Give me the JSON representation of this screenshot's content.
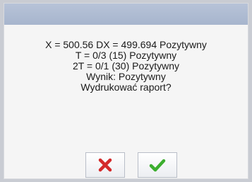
{
  "dialog": {
    "lines": [
      "X = 500.56 DX = 499.694 Pozytywny",
      "T = 0/3 (15) Pozytywny",
      "2T = 0/1 (30) Pozytywny",
      "Wynik: Pozytywny",
      "Wydrukować raport?"
    ],
    "cancel_icon": "red-x-icon",
    "confirm_icon": "green-check-icon",
    "colors": {
      "cancel": "#d42b2b",
      "confirm": "#3cae2f",
      "titlebar": "#b0bdd3"
    }
  }
}
